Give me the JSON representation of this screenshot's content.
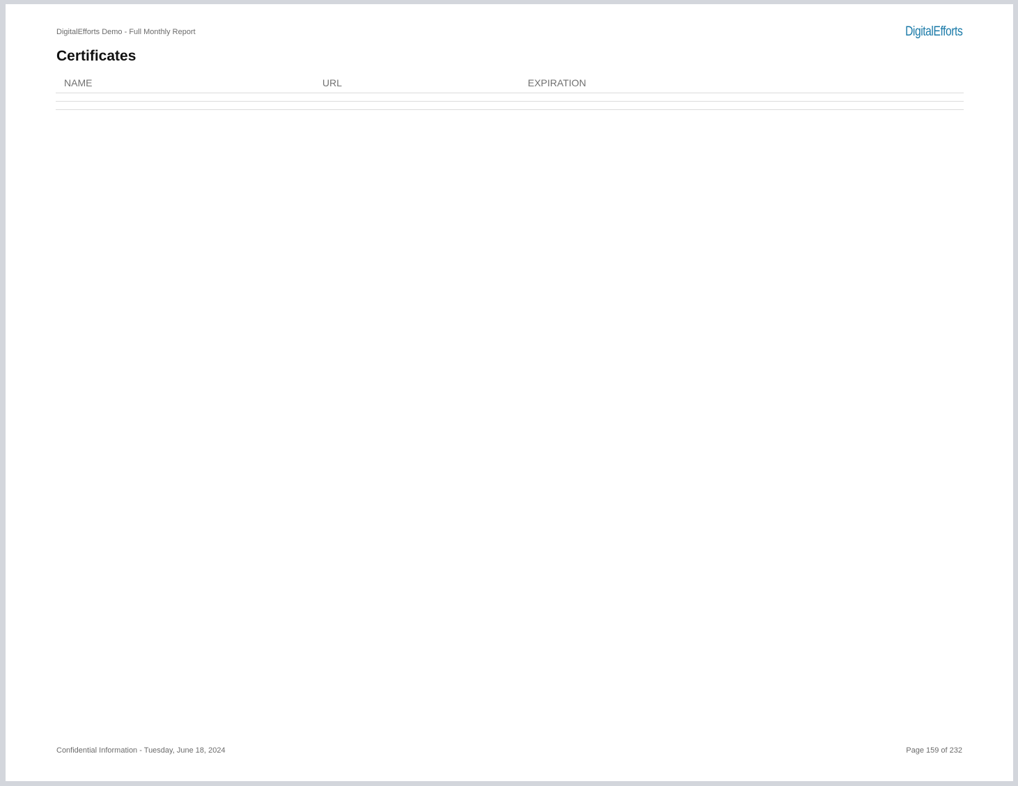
{
  "header": {
    "report_title": "DigitalEfforts Demo - Full Monthly Report",
    "brand": "DigitalEfforts"
  },
  "section": {
    "title": "Certificates"
  },
  "table": {
    "columns": [
      "NAME",
      "URL",
      "EXPIRATION"
    ],
    "rows": [
      [],
      []
    ]
  },
  "footer": {
    "confidential": "Confidential Information - Tuesday, June 18, 2024",
    "page": "Page 159 of 232"
  },
  "colors": {
    "brand": "#1a7aa8",
    "background": "#d3d6dc"
  }
}
